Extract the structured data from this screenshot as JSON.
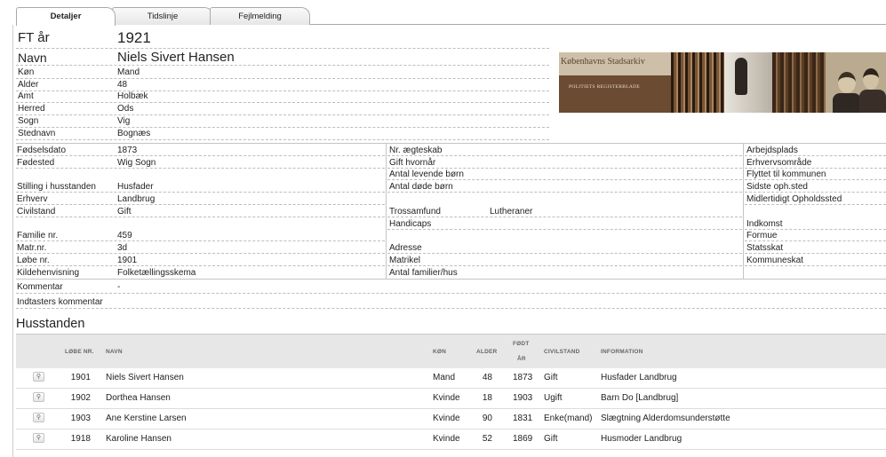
{
  "tabs": [
    "Detaljer",
    "Tidslinje",
    "Fejlmelding"
  ],
  "header": {
    "ft_label": "FT år",
    "ft_value": "1921",
    "navn_label": "Navn",
    "navn_value": "Niels Sivert Hansen"
  },
  "person_fields": [
    {
      "label": "Køn",
      "value": "Mand"
    },
    {
      "label": "Alder",
      "value": "48"
    },
    {
      "label": "Amt",
      "value": "Holbæk"
    },
    {
      "label": "Herred",
      "value": "Ods"
    },
    {
      "label": "Sogn",
      "value": "Vig"
    },
    {
      "label": "Stednavn",
      "value": "Bognæs"
    }
  ],
  "banner": {
    "title": "Københavns Stadsarkiv",
    "subtitle": "POLITIETS REGISTERBLADE"
  },
  "info": {
    "col1": [
      {
        "label": "Fødselsdato",
        "value": "1873"
      },
      {
        "label": "Fødested",
        "value": "Wig Sogn"
      },
      {
        "label": "",
        "value": ""
      },
      {
        "label": "Stilling i husstanden",
        "value": "Husfader"
      },
      {
        "label": "Erhverv",
        "value": "Landbrug"
      },
      {
        "label": "Civilstand",
        "value": "Gift"
      },
      {
        "label": "",
        "value": ""
      },
      {
        "label": "Familie nr.",
        "value": "459"
      },
      {
        "label": "Matr.nr.",
        "value": "3d"
      },
      {
        "label": "Løbe nr.",
        "value": "1901"
      },
      {
        "label": "Kildehenvisning",
        "value": "Folketællingsskema"
      }
    ],
    "col2": [
      {
        "label": "Nr. ægteskab",
        "value": ""
      },
      {
        "label": "Gift hvornår",
        "value": ""
      },
      {
        "label": "Antal levende børn",
        "value": ""
      },
      {
        "label": "Antal døde børn",
        "value": ""
      },
      {
        "label": "",
        "value": ""
      },
      {
        "label": "Trossamfund",
        "value": "Lutheraner"
      },
      {
        "label": "Handicaps",
        "value": ""
      },
      {
        "label": "",
        "value": ""
      },
      {
        "label": "Adresse",
        "value": ""
      },
      {
        "label": "Matrikel",
        "value": ""
      },
      {
        "label": "Antal familier/hus",
        "value": ""
      }
    ],
    "col3": [
      {
        "label": "Arbejdsplads"
      },
      {
        "label": "Erhvervsområde"
      },
      {
        "label": "Flyttet til kommunen"
      },
      {
        "label": "Sidste oph.sted"
      },
      {
        "label": "Midlertidigt Opholdssted"
      },
      {
        "label": ""
      },
      {
        "label": "Indkomst"
      },
      {
        "label": "Formue"
      },
      {
        "label": "Statsskat"
      },
      {
        "label": "Kommuneskat"
      }
    ],
    "kommentar_label": "Kommentar",
    "kommentar_value": "-",
    "indtasters_label": "Indtasters kommentar"
  },
  "household": {
    "title": "Husstanden",
    "headers": {
      "lobe": "LØBE NR.",
      "navn": "NAVN",
      "kon": "KØN",
      "alder": "ALDER",
      "fodt1": "FØDT",
      "fodt2": "ÅR",
      "civil": "CIVILSTAND",
      "info": "INFORMATION"
    },
    "rows": [
      {
        "lobe": "1901",
        "navn": "Niels Sivert Hansen",
        "kon": "Mand",
        "alder": "48",
        "fodt": "1873",
        "civil": "Gift",
        "info": "Husfader Landbrug"
      },
      {
        "lobe": "1902",
        "navn": "Dorthea Hansen",
        "kon": "Kvinde",
        "alder": "18",
        "fodt": "1903",
        "civil": "Ugift",
        "info": "Barn Do [Landbrug]"
      },
      {
        "lobe": "1903",
        "navn": "Ane Kerstine Larsen",
        "kon": "Kvinde",
        "alder": "90",
        "fodt": "1831",
        "civil": "Enke(mand)",
        "info": "Slægtning Alderdomsunderstøtte"
      },
      {
        "lobe": "1918",
        "navn": "Karoline Hansen",
        "kon": "Kvinde",
        "alder": "52",
        "fodt": "1869",
        "civil": "Gift",
        "info": "Husmoder Landbrug"
      }
    ]
  }
}
